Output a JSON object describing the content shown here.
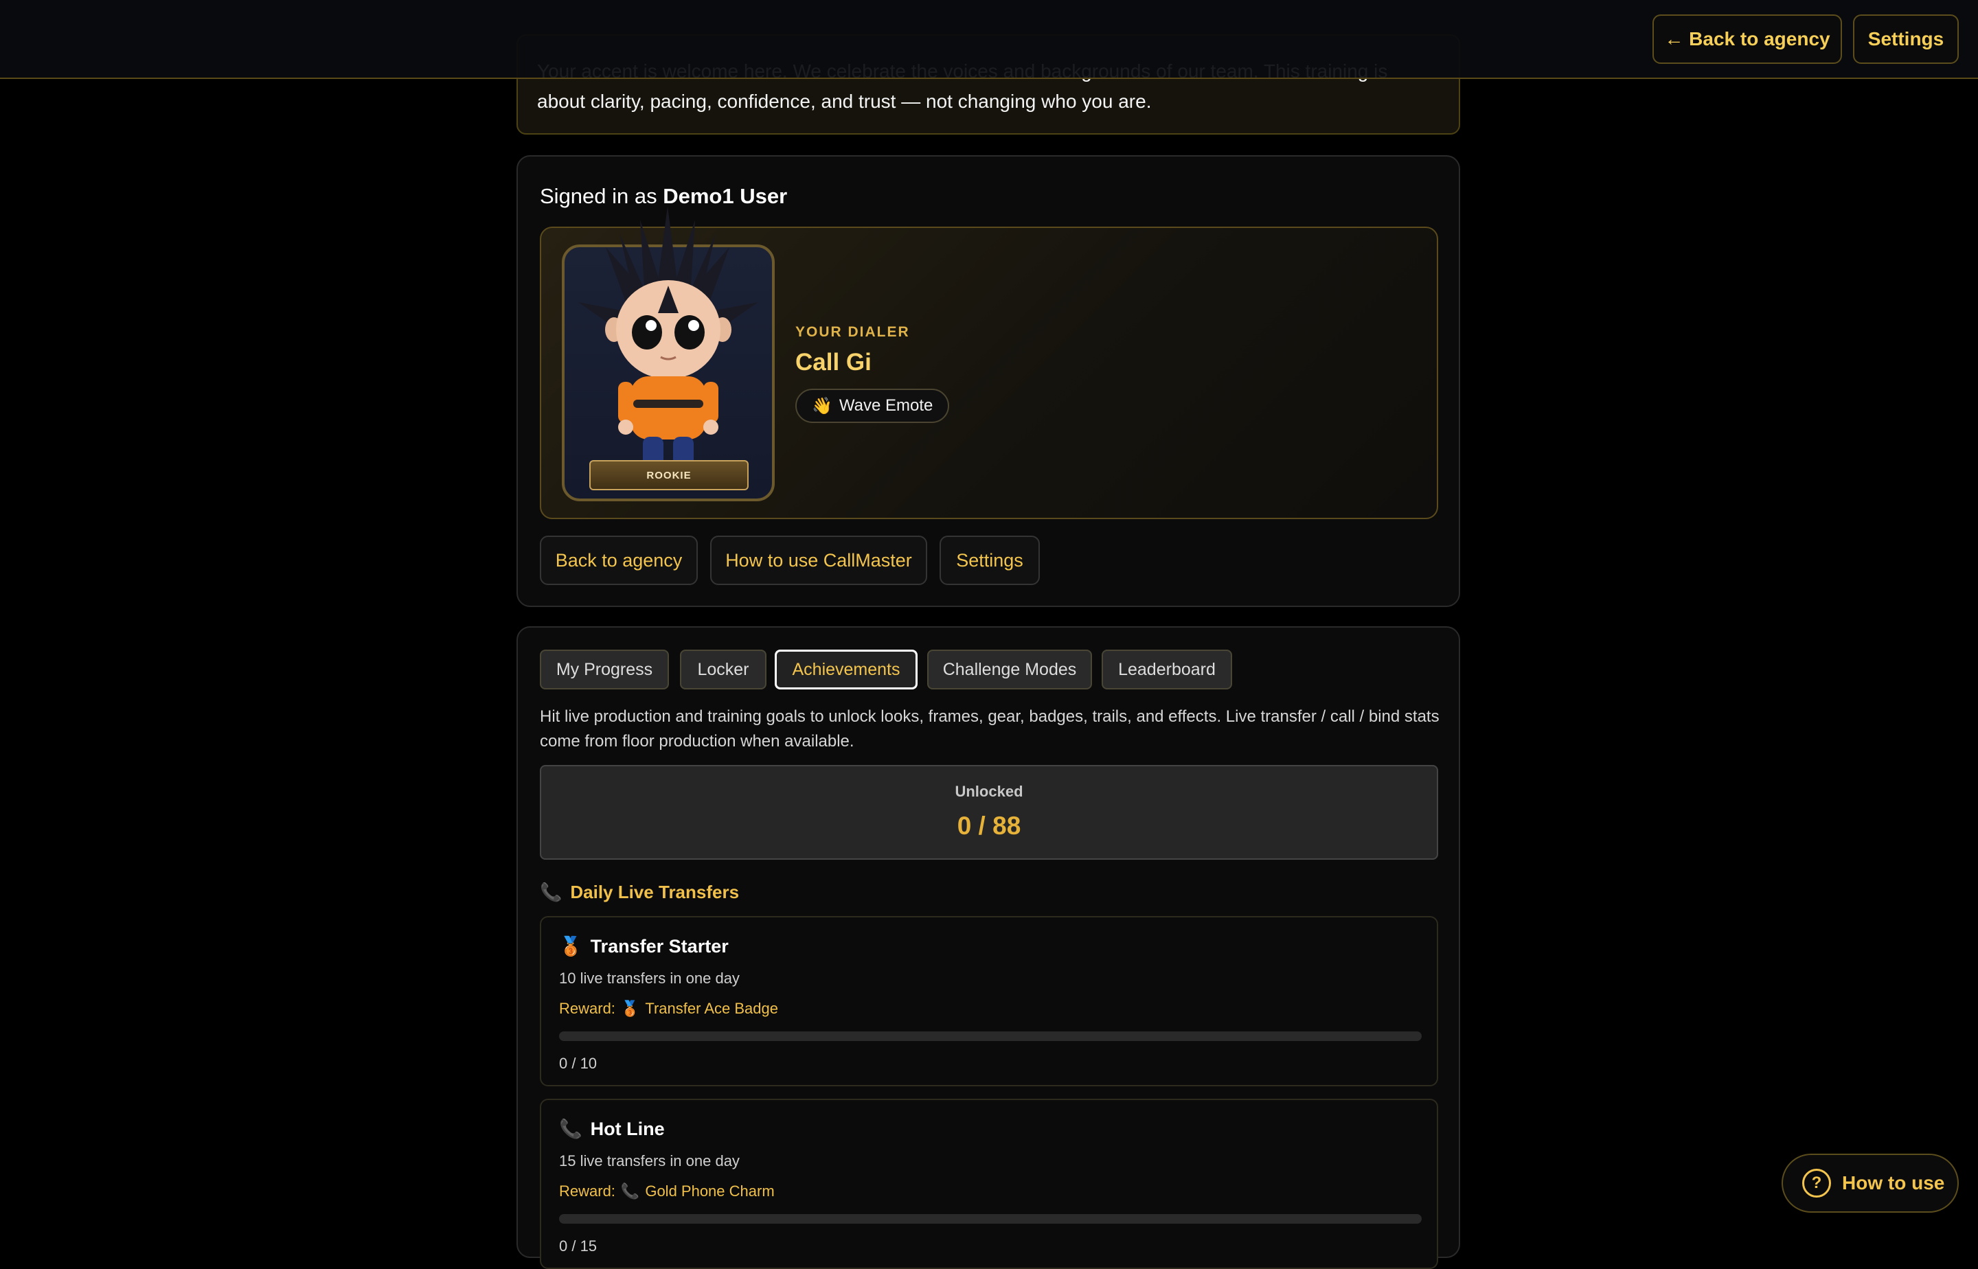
{
  "notice": {
    "text": "Your accent is welcome here. We celebrate the voices and backgrounds of our team. This training is about clarity, pacing, confidence, and trust — not changing who you are."
  },
  "topbar": {
    "back_label": "← Back to agency",
    "settings_label": "Settings"
  },
  "profile": {
    "signed_prefix": "Signed in as ",
    "user_name": "Demo1 User",
    "dialer_label": "YOUR DIALER",
    "dialer_name": "Call Gi",
    "rank": "ROOKIE",
    "emote": {
      "icon": "👋",
      "label": "Wave Emote"
    },
    "actions": [
      {
        "label": "Back to agency"
      },
      {
        "label": "How to use CallMaster"
      },
      {
        "label": "Settings"
      }
    ]
  },
  "tabs": [
    {
      "label": "My Progress"
    },
    {
      "label": "Locker"
    },
    {
      "label": "Achievements"
    },
    {
      "label": "Challenge Modes"
    },
    {
      "label": "Leaderboard"
    }
  ],
  "achievements": {
    "description": "Hit live production and training goals to unlock looks, frames, gear, badges, trails, and effects. Live transfer / call / bind stats come from floor production when available.",
    "unlocked_label": "Unlocked",
    "unlocked_value": "0 / 88",
    "section": {
      "icon": "📞",
      "title": "Daily Live Transfers"
    },
    "reward_prefix": "Reward:",
    "items": [
      {
        "icon": "🥉",
        "title": "Transfer Starter",
        "desc": "10 live transfers in one day",
        "reward_icon": "🥉",
        "reward": "Transfer Ace Badge",
        "progress_text": "0 / 10",
        "progress_fraction": 0
      },
      {
        "icon": "📞",
        "title": "Hot Line",
        "desc": "15 live transfers in one day",
        "reward_icon": "📞",
        "reward": "Gold Phone Charm",
        "progress_text": "0 / 15",
        "progress_fraction": 0
      }
    ]
  },
  "help": {
    "icon": "?",
    "label": "How to use"
  },
  "colors": {
    "accent": "#f3c54e",
    "gold": "#e6b23a",
    "background": "#000000",
    "card": "#0b0b0b"
  }
}
